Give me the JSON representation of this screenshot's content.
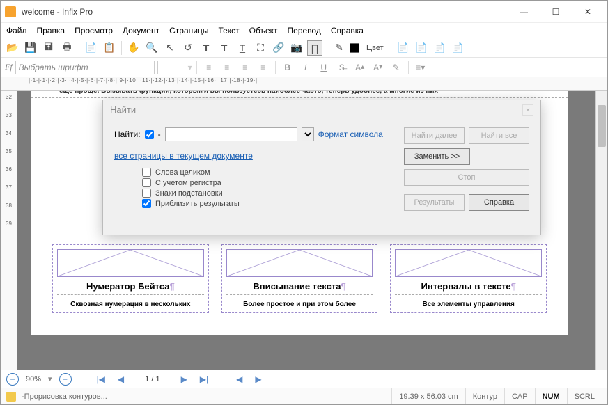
{
  "title": "welcome - Infix Pro",
  "menu": [
    "Файл",
    "Правка",
    "Просмотр",
    "Документ",
    "Страницы",
    "Текст",
    "Объект",
    "Перевод",
    "Справка"
  ],
  "toolbar2": {
    "font_placeholder": "Выбрать шрифт",
    "color_label": "Цвет"
  },
  "ruler_v": [
    "32",
    "33",
    "34",
    "35",
    "36",
    "37",
    "38",
    "39"
  ],
  "ruler_h": "|·1·|·1·|·2·|·3·|·4·|·5·|·6·|·7·|·8·|·9·|·10·|·11·|·12·|·13·|·14·|·15·|·16·|·17·|·18·|·19·|",
  "page_top": "еще проще. Вызывать функции, которыми вы пользуетесь наиболее часто, теперь удобнее, а многие из них",
  "cards": [
    {
      "title": "Нумератор Бейтса",
      "sub": "Сквозная нумерация в нескольких"
    },
    {
      "title": "Вписывание текста",
      "sub": "Более простое и при этом более"
    },
    {
      "title": "Интервалы в тексте",
      "sub": "Все элементы управления"
    }
  ],
  "dialog": {
    "title": "Найти",
    "find_label": "Найти:",
    "format_link": "Формат символа",
    "scope_link": "все страницы в текущем документе",
    "checks": {
      "whole": "Слова целиком",
      "case": "С учетом регистра",
      "wildcards": "Знаки подстановки",
      "zoom": "Приблизить результаты"
    },
    "buttons": {
      "next": "Найти далее",
      "all": "Найти все",
      "replace": "Заменить >>",
      "stop": "Стоп",
      "results": "Результаты",
      "help": "Справка"
    }
  },
  "nav": {
    "zoom": "90%",
    "page": "1 / 1"
  },
  "status": {
    "msg": "Прорисовка контуров...",
    "coords": "19.39 x 56.03 cm",
    "mode": "Контур",
    "cap": "CAP",
    "num": "NUM",
    "scrl": "SCRL"
  }
}
